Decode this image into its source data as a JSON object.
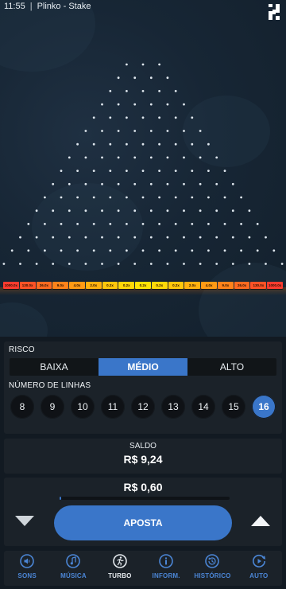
{
  "status_bar": {
    "time": "11:55",
    "app_title": "Plinko - Stake"
  },
  "board": {
    "peg_rows": 16,
    "multipliers": [
      {
        "label": "1000.0x",
        "color": "#ff3b2f"
      },
      {
        "label": "130.0x",
        "color": "#ff5226"
      },
      {
        "label": "26.0x",
        "color": "#ff6a20"
      },
      {
        "label": "9.0x",
        "color": "#ff821a"
      },
      {
        "label": "4.0x",
        "color": "#ff9a14"
      },
      {
        "label": "2.0x",
        "color": "#ffb10f"
      },
      {
        "label": "0.2x",
        "color": "#ffc70b"
      },
      {
        "label": "0.2x",
        "color": "#ffd808"
      },
      {
        "label": "0.2x",
        "color": "#ffe306"
      },
      {
        "label": "0.2x",
        "color": "#ffd808"
      },
      {
        "label": "0.2x",
        "color": "#ffc70b"
      },
      {
        "label": "2.0x",
        "color": "#ffb10f"
      },
      {
        "label": "4.0x",
        "color": "#ff9a14"
      },
      {
        "label": "9.0x",
        "color": "#ff821a"
      },
      {
        "label": "26.0x",
        "color": "#ff6a20"
      },
      {
        "label": "130.0x",
        "color": "#ff5226"
      },
      {
        "label": "1000.0x",
        "color": "#ff3b2f"
      }
    ]
  },
  "risk": {
    "label": "RISCO",
    "options": [
      "BAIXA",
      "MÉDIO",
      "ALTO"
    ],
    "selected": "MÉDIO"
  },
  "rows": {
    "label": "NÚMERO DE LINHAS",
    "options": [
      "8",
      "9",
      "10",
      "11",
      "12",
      "13",
      "14",
      "15",
      "16"
    ],
    "selected": "16"
  },
  "balance": {
    "title": "SALDO",
    "value": "R$ 9,24"
  },
  "bet": {
    "amount": "R$ 0,60",
    "button_label": "APOSTA",
    "slider_fraction": 0.01
  },
  "nav": {
    "items": [
      {
        "label": "SONS",
        "icon": "speaker-icon"
      },
      {
        "label": "MÚSICA",
        "icon": "music-note-icon"
      },
      {
        "label": "TURBO",
        "icon": "turbo-runner-icon"
      },
      {
        "label": "INFORM.",
        "icon": "info-icon"
      },
      {
        "label": "HISTÓRICO",
        "icon": "history-icon"
      },
      {
        "label": "AUTO",
        "icon": "autoplay-icon"
      }
    ],
    "active": "TURBO"
  },
  "colors": {
    "accent": "#3a76c9",
    "panel": "#1b2229",
    "nav_label": "#4b86d6"
  }
}
